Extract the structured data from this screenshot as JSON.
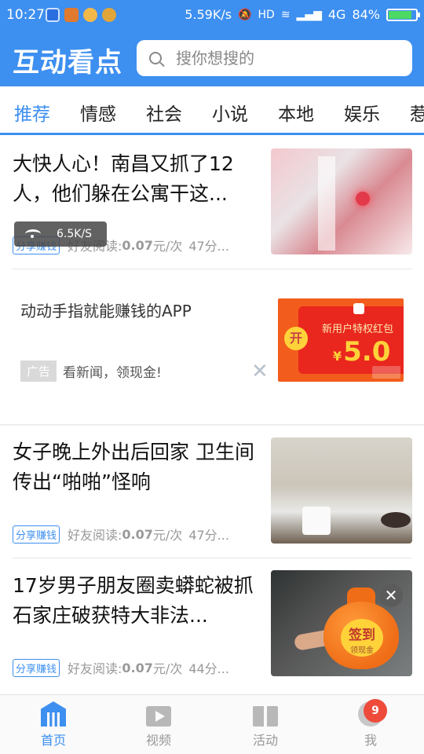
{
  "status_bar": {
    "time": "10:27",
    "network_speed": "5.59K/s",
    "hd": "HD",
    "network_type": "4G",
    "battery": "84%",
    "battery_level": 0.84
  },
  "header": {
    "app_title": "互动看点",
    "search_placeholder": "搜你想搜的"
  },
  "tabs": [
    {
      "label": "推荐",
      "active": true
    },
    {
      "label": "情感"
    },
    {
      "label": "社会"
    },
    {
      "label": "小说"
    },
    {
      "label": "本地"
    },
    {
      "label": "娱乐"
    },
    {
      "label": "惹"
    }
  ],
  "speed_overlay": "6.5K/S",
  "feed": [
    {
      "title": "大快人心！南昌又抓了12人，他们躲在公寓干这...",
      "tag": "分享赚钱",
      "read_label": "好友阅读:",
      "price": "0.07",
      "unit": "元/次",
      "time": "47分..."
    },
    {
      "ad_title": "动动手指就能赚钱的APP",
      "ad_tag": "广告",
      "ad_desc": "看新闻，领现金!",
      "ad_image": {
        "coin_text": "开",
        "headline": "新用户特权红包",
        "currency": "¥",
        "amount": "5.0"
      }
    },
    {
      "title": "女子晚上外出后回家 卫生间传出“啪啪”怪响",
      "tag": "分享赚钱",
      "read_label": "好友阅读:",
      "price": "0.07",
      "unit": "元/次",
      "time": "47分..."
    },
    {
      "title": "17岁男子朋友圈卖蟒蛇被抓 石家庄破获特大非法...",
      "tag": "分享赚钱",
      "read_label": "好友阅读:",
      "price": "0.07",
      "unit": "元/次",
      "time": "44分..."
    }
  ],
  "checkin": {
    "big": "签到",
    "small": "领现金"
  },
  "bottom_nav": [
    {
      "label": "首页",
      "icon": "home-icon",
      "active": true
    },
    {
      "label": "视频",
      "icon": "video-icon"
    },
    {
      "label": "活动",
      "icon": "gift-icon"
    },
    {
      "label": "我",
      "icon": "profile-icon",
      "badge": "9"
    }
  ],
  "colors": {
    "brand_blue": "#3d8ff0",
    "badge_red": "#ee4b3a"
  }
}
